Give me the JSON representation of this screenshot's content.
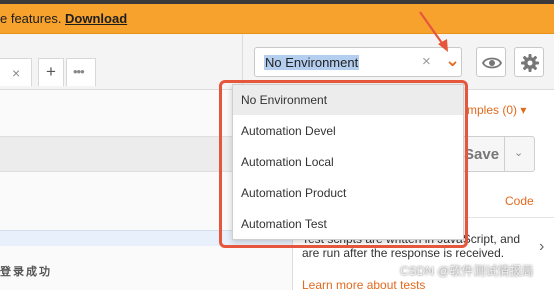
{
  "banner": {
    "text": "e features. ",
    "link": "Download"
  },
  "tabs": {
    "close_symbol": "×",
    "add_symbol": "+",
    "more_symbol": "•••"
  },
  "environment": {
    "selected": "No Environment",
    "clear_symbol": "×",
    "chevron": "⌄"
  },
  "right_panel": {
    "examples_label": "mples (0) ▾",
    "save_label": "Save",
    "save_chevron": "⌄",
    "code_link": "Code",
    "snippet_text": "Test scripts are written in JavaScript, and are run after the response is received.",
    "learn_more": "Learn more about tests",
    "snippet_arrow": "›"
  },
  "left_panel": {
    "login_text": "登录成功"
  },
  "dropdown": {
    "items": [
      {
        "label": "No Environment",
        "selected": true
      },
      {
        "label": "Automation Devel",
        "selected": false
      },
      {
        "label": "Automation Local",
        "selected": false
      },
      {
        "label": "Automation Product",
        "selected": false
      },
      {
        "label": "Automation Test",
        "selected": false
      }
    ]
  },
  "watermark": "CSDN @软件测试情报局",
  "colors": {
    "banner_bg": "#f7a22d",
    "accent_orange": "#e26a1e",
    "annotation_red": "#e5563c",
    "selection_blue": "#b4cef0"
  }
}
